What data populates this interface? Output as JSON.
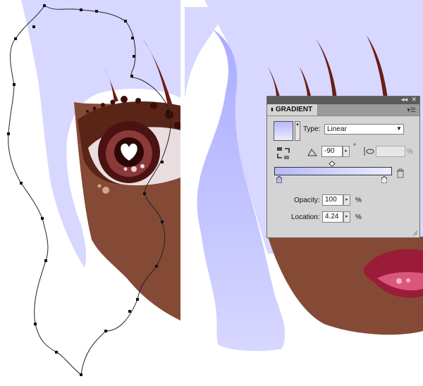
{
  "colors": {
    "hair": "#d7d7ff",
    "hair_gradient_dark": "#a9acff",
    "skin": "#844a35",
    "skin_dark": "#5a2516",
    "lips": "#9b1c38",
    "gradient_start": "#b5b9ff",
    "gradient_end": "#ebedff",
    "panel_bg": "#d4d4d4"
  },
  "panel": {
    "title": "GRADIENT",
    "collapse_icon": "double-arrow-icon",
    "close_icon": "close-icon",
    "menu_icon": "panel-menu-icon",
    "type_label": "Type:",
    "type_value": "Linear",
    "angle_value": "-90",
    "degree_symbol": "°",
    "percent_symbol": "%",
    "opacity_label": "Opacity:",
    "opacity_value": "100",
    "location_label": "Location:",
    "location_value": "4.24"
  }
}
